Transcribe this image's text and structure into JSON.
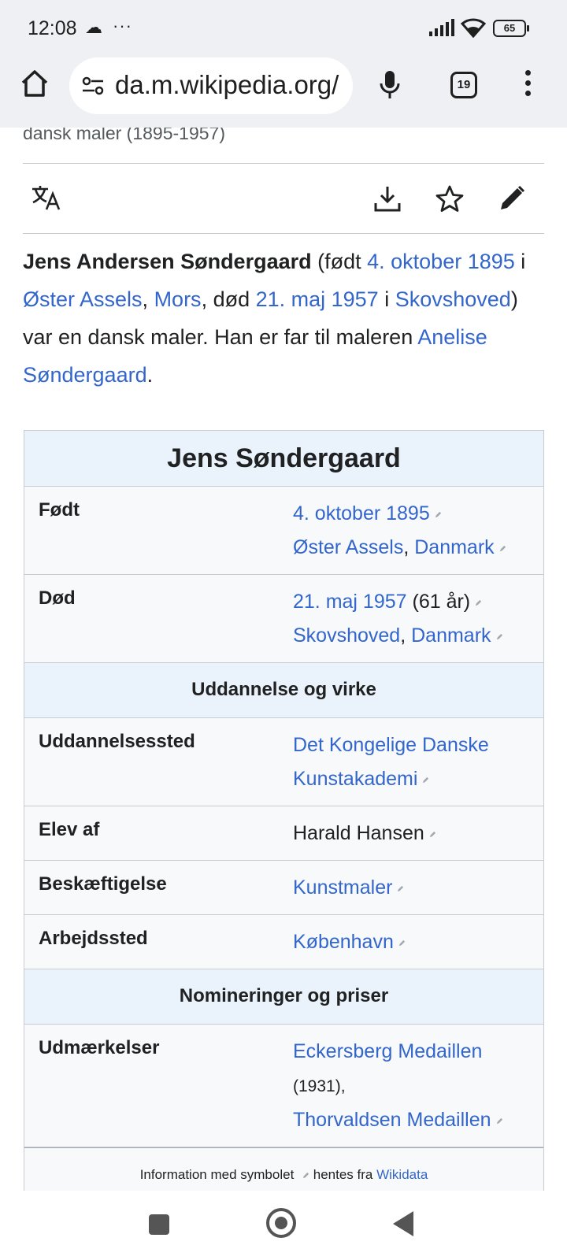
{
  "status": {
    "time": "12:08",
    "more": "···",
    "battery": "65"
  },
  "browser": {
    "url": "da.m.wikipedia.org/",
    "tab_count": "19"
  },
  "article": {
    "subtitle": "dansk maler (1895-1957)",
    "intro": {
      "name": "Jens Andersen Søndergaard",
      "t1": " (født ",
      "birth_date": "4. oktober 1895",
      "t2": " i ",
      "birth_place": "Øster Assels",
      "t3": ", ",
      "birth_region": "Mors",
      "t4": ", død ",
      "death_date": "21. maj 1957",
      "t5": " i ",
      "death_place": "Skovshoved",
      "t6": ") var en dansk maler. Han er far til maleren ",
      "child": "Anelise Søndergaard",
      "t7": "."
    }
  },
  "infobox": {
    "title": "Jens Søndergaard",
    "born": {
      "label": "Født",
      "date": "4. oktober 1895",
      "place": "Øster Assels",
      "country": "Danmark"
    },
    "died": {
      "label": "Død",
      "date": "21. maj 1957",
      "age": " (61 år)",
      "place": "Skovshoved",
      "country": "Danmark"
    },
    "section1": "Uddannelse og virke",
    "education": {
      "label": "Uddannelsessted",
      "value": "Det Kongelige Danske Kunstakademi"
    },
    "student_of": {
      "label": "Elev af",
      "value": "Harald Hansen"
    },
    "occupation": {
      "label": "Beskæftigelse",
      "value": "Kunstmaler"
    },
    "workplace": {
      "label": "Arbejdssted",
      "value": "København"
    },
    "section2": "Nomineringer og priser",
    "awards": {
      "label": "Udmærkelser",
      "award1": "Eckersberg Medaillen",
      "award1_year": "(1931),",
      "award2": "Thorvaldsen Medaillen"
    },
    "footer": {
      "t1": "Information med symbolet",
      "t2": "hentes fra",
      "link": "Wikidata"
    }
  },
  "colors": {
    "link": "#3366cc",
    "infobox_header": "#eaf3fb",
    "chrome": "#eef0f4"
  }
}
